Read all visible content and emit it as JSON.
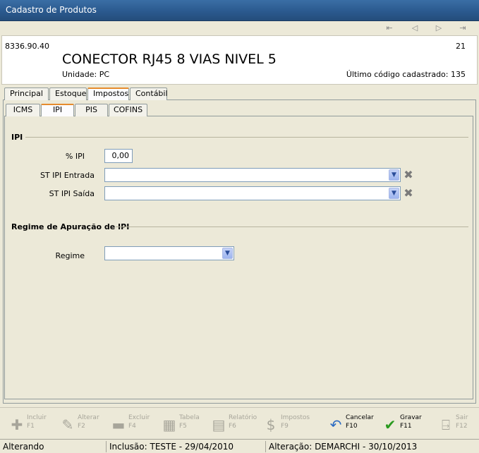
{
  "window": {
    "title": "Cadastro de Produtos"
  },
  "nav": {
    "first": "⇤",
    "prev": "◁",
    "next": "▷",
    "last": "⇥"
  },
  "header": {
    "code": "8336.90.40",
    "number": "21",
    "description": "CONECTOR RJ45 8 VIAS NIVEL 5",
    "unit": "Unidade:  PC",
    "last_code": "Último código cadastrado: 135"
  },
  "main_tabs": [
    "Principal",
    "Estoque",
    "Impostos",
    "Contábil"
  ],
  "sub_tabs": [
    "ICMS",
    "IPI",
    "PIS",
    "COFINS"
  ],
  "ipi_section": {
    "title": "IPI",
    "pct_label": "% IPI",
    "pct_value": "0,00",
    "st_entrada_label": "ST IPI Entrada",
    "st_entrada_value": "",
    "st_saida_label": "ST IPI Saída",
    "st_saida_value": ""
  },
  "regime_section": {
    "title": "Regime de Apuração de IPI",
    "regime_label": "Regime",
    "regime_value": ""
  },
  "toolbar": [
    {
      "label": "Incluir",
      "key": "F1",
      "icon": "plus-icon",
      "enabled": false
    },
    {
      "label": "Alterar",
      "key": "F2",
      "icon": "pencil-icon",
      "enabled": false
    },
    {
      "label": "Excluir",
      "key": "F4",
      "icon": "minus-icon",
      "enabled": false
    },
    {
      "label": "Tabela",
      "key": "F5",
      "icon": "table-icon",
      "enabled": false
    },
    {
      "label": "Relatório",
      "key": "F6",
      "icon": "report-icon",
      "enabled": false
    },
    {
      "label": "Impostos",
      "key": "F9",
      "icon": "money-bag-icon",
      "enabled": false
    },
    {
      "label": "Cancelar",
      "key": "F10",
      "icon": "undo-icon",
      "enabled": true
    },
    {
      "label": "Gravar",
      "key": "F11",
      "icon": "checkmark-icon",
      "enabled": true
    },
    {
      "label": "Sair",
      "key": "F12",
      "icon": "exit-door-icon",
      "enabled": false
    }
  ],
  "status": {
    "mode": "Alterando",
    "inclusion": "Inclusão: TESTE - 29/04/2010",
    "alteration": "Alteração: DEMARCHI - 30/10/2013"
  },
  "colors": {
    "title_bar": "#2b5a8f",
    "active_tab_accent": "#e68b2c",
    "gravar_green": "#2a9a1f",
    "cancelar_blue": "#2a6ac2"
  }
}
